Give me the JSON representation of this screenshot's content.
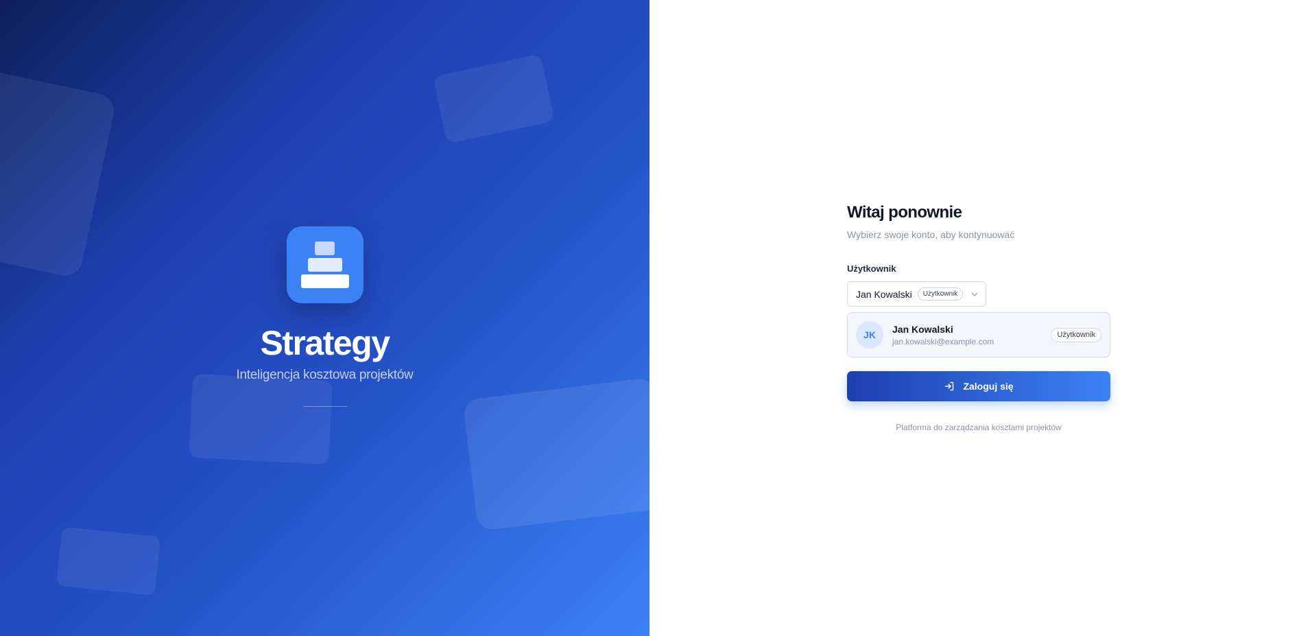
{
  "brand": {
    "name": "Strategy",
    "tagline": "Inteligencja kosztowa projektów"
  },
  "login": {
    "title": "Witaj ponownie",
    "subtitle": "Wybierz swoje konto, aby kontynuować",
    "user_label": "Użytkownik",
    "selected_user": {
      "name": "Jan Kowalski",
      "role": "Użytkownik"
    },
    "account_card": {
      "initials": "JK",
      "name": "Jan Kowalski",
      "email": "jan.kowalski@example.com",
      "role": "Użytkownik"
    },
    "submit_label": "Zaloguj się",
    "footer": "Platforma do zarządzania kosztami projektów"
  },
  "icons": {
    "logo": "stacked-blocks-icon",
    "select_chevron": "chevron-down-icon",
    "submit": "log-in-icon"
  },
  "colors": {
    "accent": "#3b82f6",
    "accent_dark": "#1e40af",
    "panel_start": "#0e1f5a",
    "panel_end": "#3b82f6",
    "text_primary": "#111827",
    "text_muted": "#8a94a6"
  }
}
